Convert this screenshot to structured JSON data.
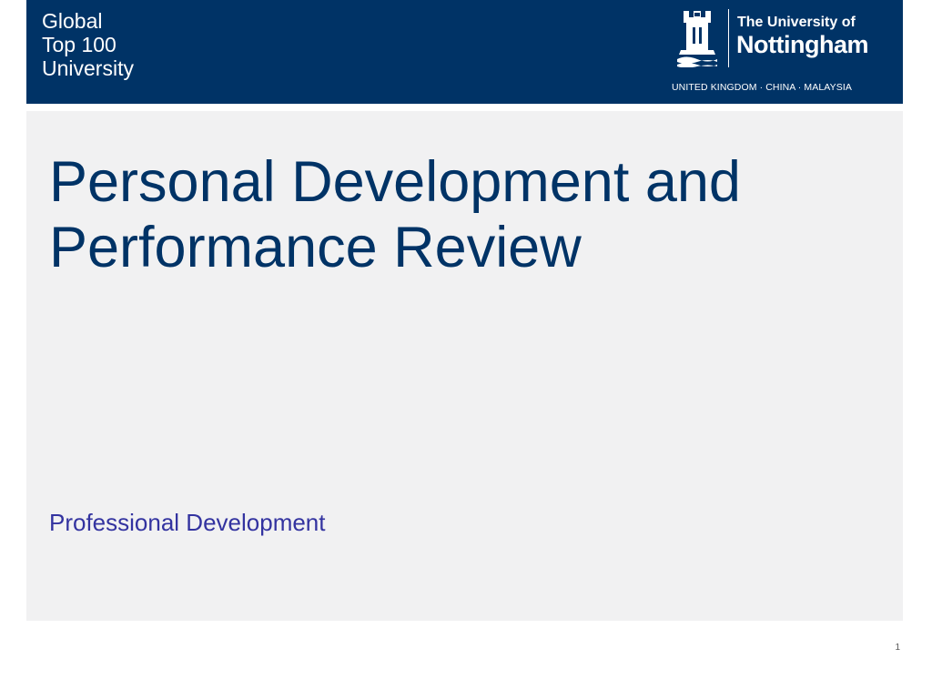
{
  "header": {
    "tagline": [
      "Global",
      "Top 100",
      "University"
    ],
    "logo": {
      "line1": "The University of",
      "line2": "Nottingham",
      "regions": "UNITED KINGDOM · CHINA · MALAYSIA",
      "icon": "castle-crest-icon"
    }
  },
  "slide": {
    "title_line1": "Personal Development and",
    "title_line2": "Performance Review",
    "subtitle": "Professional Development",
    "page_number": "1"
  },
  "colors": {
    "header_bg": "#003366",
    "content_bg": "#f1f1f2",
    "title": "#003366",
    "subtitle": "#3333a0"
  }
}
